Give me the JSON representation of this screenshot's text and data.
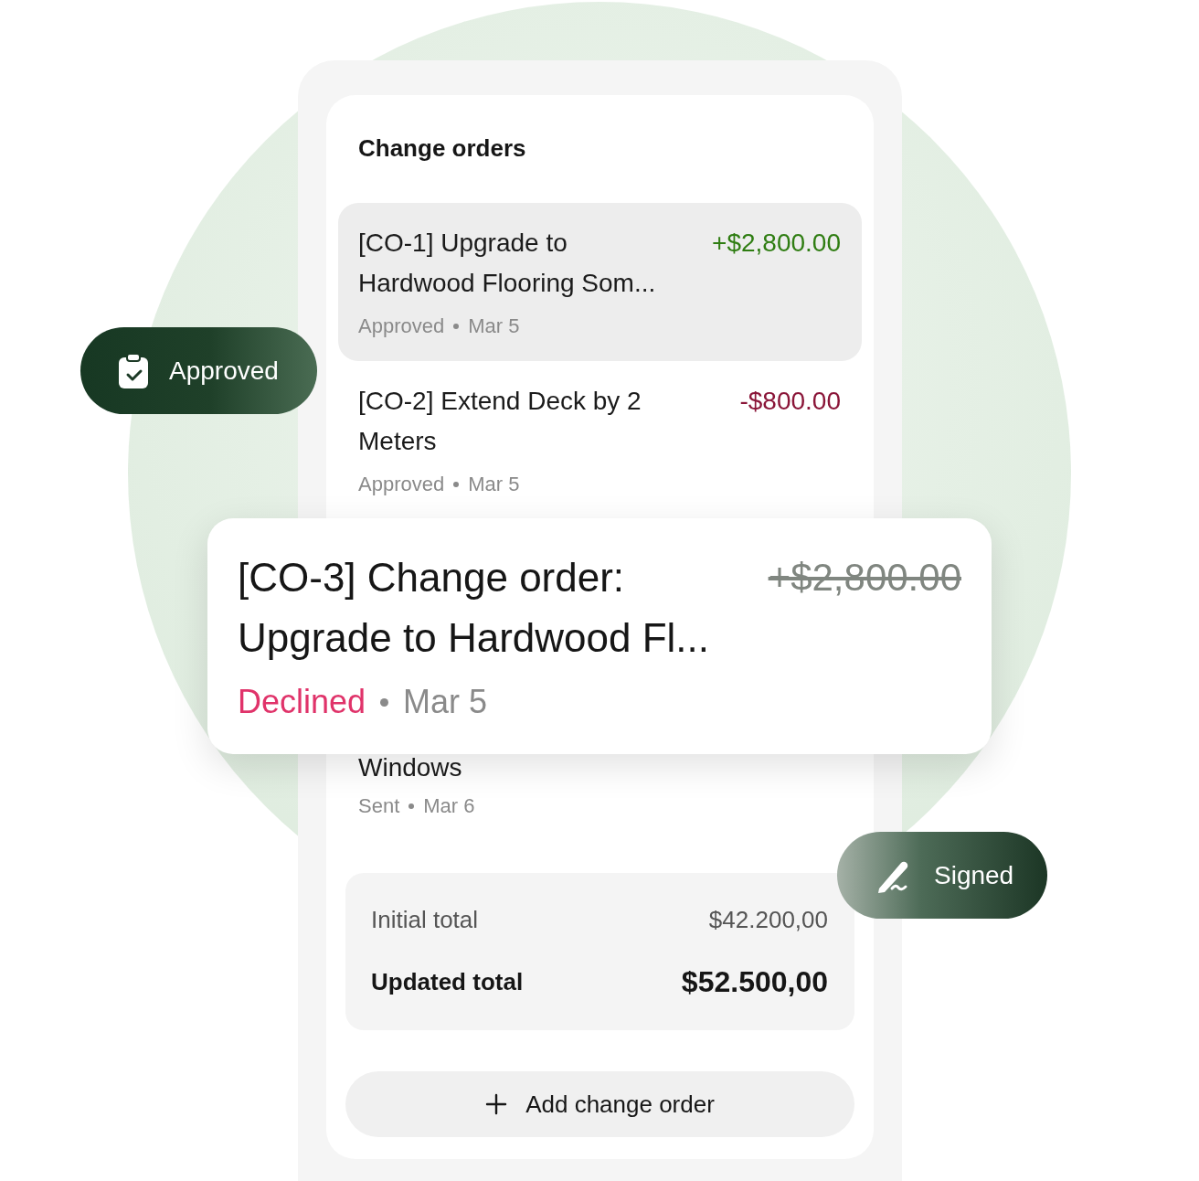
{
  "title": "Change orders",
  "items": [
    {
      "title": "[CO-1] Upgrade to Hardwood Flooring Som...",
      "amount": "+$2,800.00",
      "kind": "increase",
      "status": "Approved",
      "date": "Mar 5",
      "selected": true
    },
    {
      "title": "[CO-2] Extend Deck by 2 Meters",
      "amount": "-$800.00",
      "kind": "decrease",
      "status": "Approved",
      "date": "Mar 5",
      "selected": false
    },
    {
      "title": "Windows",
      "status": "Sent",
      "date": "Mar 6",
      "selected": false
    }
  ],
  "featured_item": {
    "title": "[CO-3] Change order: Upgrade to Hardwood Fl...",
    "amount": "+$2,800.00",
    "struck": true,
    "status": "Declined",
    "kind": "declined",
    "date": "Mar 5"
  },
  "totals": [
    {
      "label": "Initial total",
      "value": "$42.200,00",
      "kind": "initial"
    },
    {
      "label": "Updated total",
      "value": "$52.500,00",
      "kind": "updated"
    }
  ],
  "add_button": {
    "label": "Add change order"
  },
  "badges": [
    {
      "label": "Approved",
      "kind": "approved"
    },
    {
      "label": "Signed",
      "kind": "signed"
    }
  ]
}
